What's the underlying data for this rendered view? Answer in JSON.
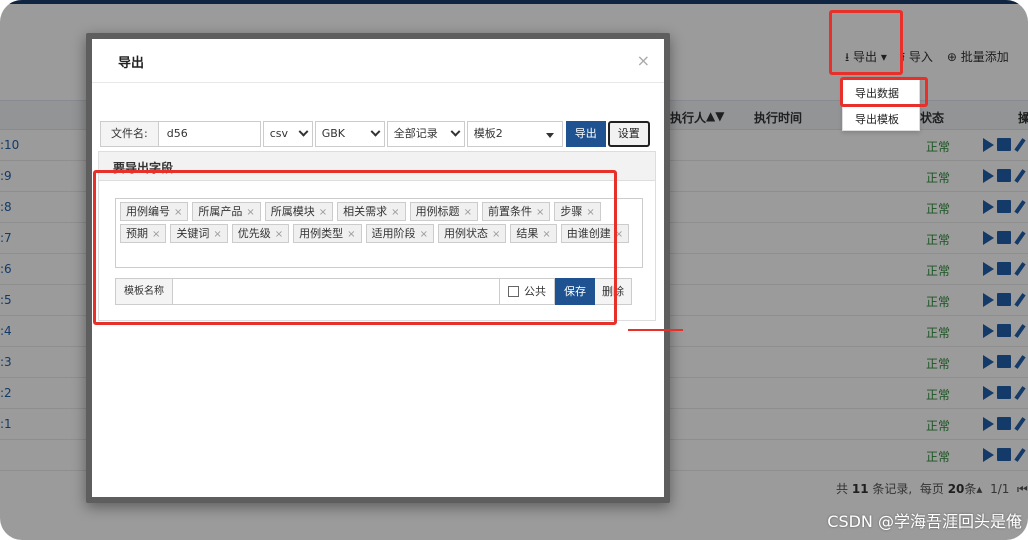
{
  "toolbar": {
    "export": "导出",
    "import": "导入",
    "batch_add": "批量添加"
  },
  "export_menu": {
    "items": [
      "导出数据",
      "导出模板"
    ]
  },
  "table": {
    "headers": {
      "executor": "执行人",
      "exec_time": "执行时间",
      "status": "状态",
      "ops": "操"
    },
    "rows": [
      {
        "id": "10",
        "status": "正常"
      },
      {
        "id": "9",
        "status": "正常"
      },
      {
        "id": "8",
        "status": "正常"
      },
      {
        "id": "7",
        "status": "正常"
      },
      {
        "id": "6",
        "status": "正常"
      },
      {
        "id": "5",
        "status": "正常"
      },
      {
        "id": "4",
        "status": "正常"
      },
      {
        "id": "3",
        "status": "正常"
      },
      {
        "id": "2",
        "status": "正常"
      },
      {
        "id": "1",
        "status": "正常"
      },
      {
        "id": "",
        "status": "正常"
      }
    ]
  },
  "pagination": {
    "total_prefix": "共",
    "total": "11",
    "total_suffix": "条记录,",
    "per_page_prefix": "每页",
    "per_page": "20",
    "per_page_suffix": "条",
    "page": "1/1"
  },
  "modal": {
    "title": "导出",
    "close": "×",
    "filename_label": "文件名:",
    "filename_value": "d56",
    "format": "csv",
    "encoding": "GBK",
    "range": "全部记录",
    "template": "模板2",
    "export_button": "导出",
    "settings_button": "设置",
    "fields_header": "要导出字段",
    "fields": [
      "用例编号",
      "所属产品",
      "所属模块",
      "相关需求",
      "用例标题",
      "前置条件",
      "步骤",
      "预期",
      "关键词",
      "优先级",
      "用例类型",
      "适用阶段",
      "用例状态",
      "结果",
      "由谁创建"
    ],
    "template_name_label": "模板名称",
    "public_label": "公共",
    "save_button": "保存",
    "delete_button": "删除"
  },
  "watermark": "CSDN @学海吾涯回头是俺"
}
